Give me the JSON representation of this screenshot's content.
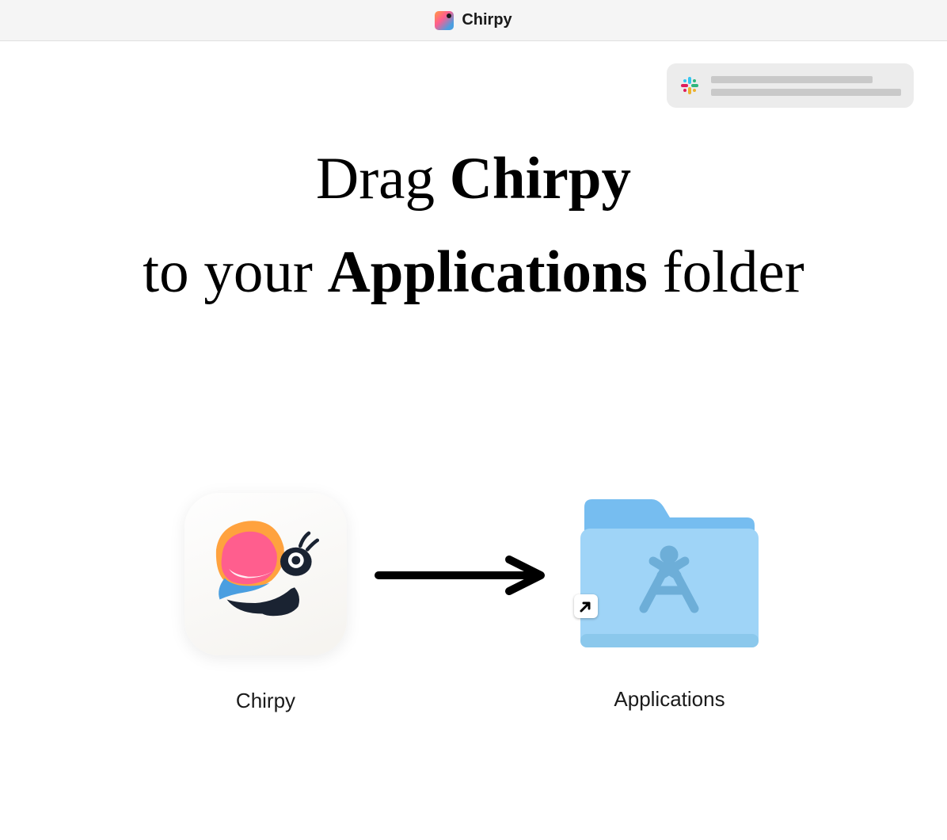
{
  "titlebar": {
    "title": "Chirpy"
  },
  "instruction": {
    "line1_pre": "Drag ",
    "line1_bold": "Chirpy",
    "line2_pre": "to your ",
    "line2_bold": "Applications",
    "line2_post": " folder"
  },
  "app": {
    "label": "Chirpy"
  },
  "folder": {
    "label": "Applications"
  }
}
